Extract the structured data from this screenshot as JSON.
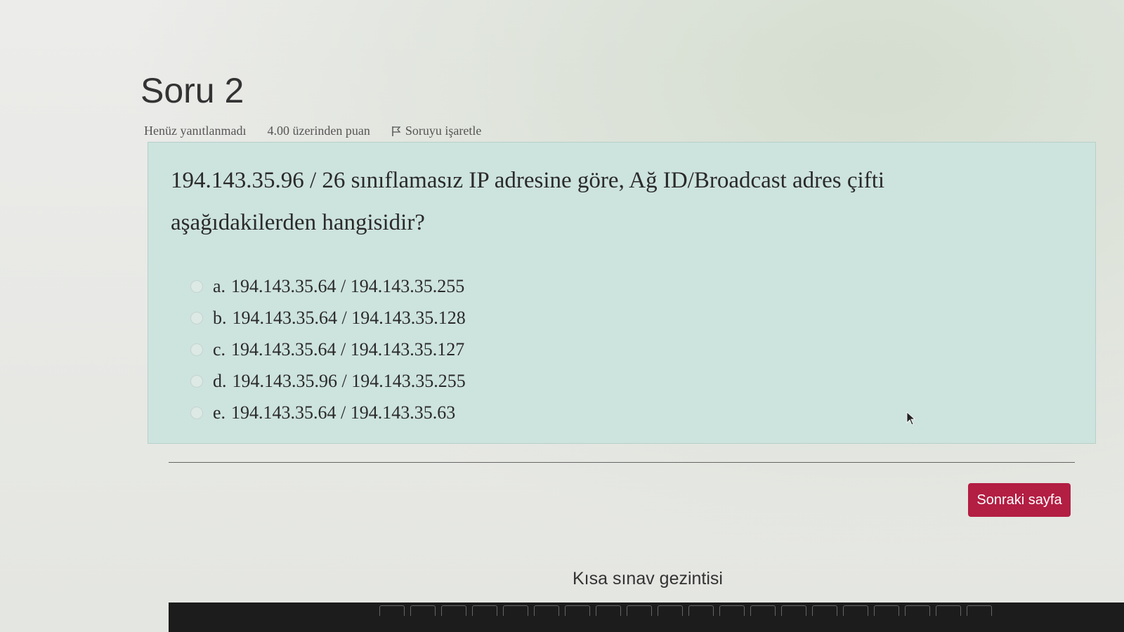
{
  "question": {
    "title": "Soru 2",
    "status": "Henüz yanıtlanmadı",
    "points": "4.00 üzerinden puan",
    "flag_label": "Soruyu işaretle",
    "text": "194.143.35.96 / 26 sınıflamasız IP adresine göre, Ağ ID/Broadcast adres çifti aşağıdakilerden hangisidir?",
    "answers": [
      {
        "letter": "a.",
        "text": "194.143.35.64 / 194.143.35.255"
      },
      {
        "letter": "b.",
        "text": "194.143.35.64 / 194.143.35.128"
      },
      {
        "letter": "c.",
        "text": "194.143.35.64 / 194.143.35.127"
      },
      {
        "letter": "d.",
        "text": "194.143.35.96 / 194.143.35.255"
      },
      {
        "letter": "e.",
        "text": "194.143.35.64 / 194.143.35.63"
      }
    ]
  },
  "actions": {
    "next_label": "Sonraki sayfa"
  },
  "navigation": {
    "title": "Kısa sınav gezintisi"
  },
  "colors": {
    "question_bg": "#cde3de",
    "next_button": "#b31e43"
  }
}
